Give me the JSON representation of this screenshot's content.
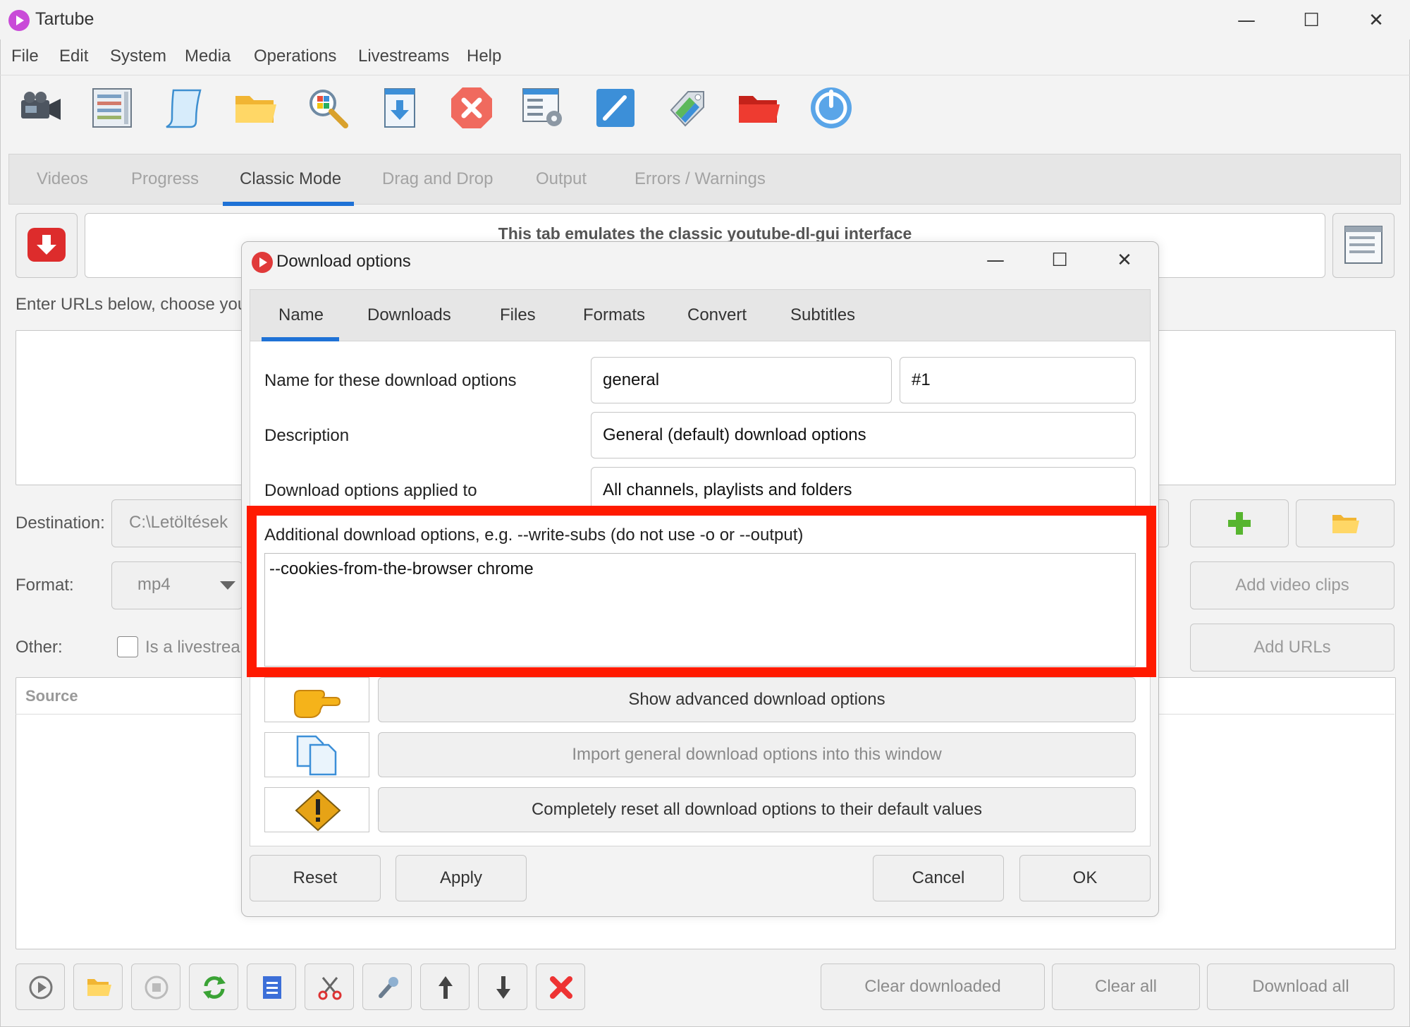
{
  "app": {
    "title": "Tartube",
    "window_controls": {
      "minimize": "—",
      "maximize": "☐",
      "close": "✕"
    }
  },
  "menubar": [
    "File",
    "Edit",
    "System",
    "Media",
    "Operations",
    "Livestreams",
    "Help"
  ],
  "toolbar_icons": [
    "camera-icon",
    "video-list-icon",
    "scroll-icon",
    "folder-icon",
    "search-icon",
    "download-icon",
    "stop-icon",
    "settings-icon",
    "edit-icon",
    "tag-icon",
    "red-folder-icon",
    "power-icon"
  ],
  "main_tabs": [
    {
      "label": "Videos",
      "active": false
    },
    {
      "label": "Progress",
      "active": false
    },
    {
      "label": "Classic Mode",
      "active": true
    },
    {
      "label": "Drag and Drop",
      "active": false
    },
    {
      "label": "Output",
      "active": false
    },
    {
      "label": "Errors / Warnings",
      "active": false
    }
  ],
  "classic": {
    "banner": "This tab emulates the classic youtube-dl-gui interface",
    "enter_urls_label": "Enter URLs below, choose your",
    "destination_label": "Destination:",
    "destination_value": "C:\\Letöltések",
    "format_label": "Format:",
    "format_value": "mp4",
    "other_label": "Other:",
    "livestream_label": "Is a livestream",
    "source_header": "Source",
    "add_video_clips": "Add video clips",
    "add_urls": "Add URLs",
    "clear_downloaded": "Clear downloaded",
    "clear_all": "Clear all",
    "download_all": "Download all"
  },
  "dialog": {
    "title": "Download options",
    "window_controls": {
      "minimize": "—",
      "maximize": "☐",
      "close": "✕"
    },
    "tabs": [
      {
        "label": "Name",
        "active": true
      },
      {
        "label": "Downloads",
        "active": false
      },
      {
        "label": "Files",
        "active": false
      },
      {
        "label": "Formats",
        "active": false
      },
      {
        "label": "Convert",
        "active": false
      },
      {
        "label": "Subtitles",
        "active": false
      }
    ],
    "name_label": "Name for these download options",
    "name_value": "general",
    "id_value": "#1",
    "description_label": "Description",
    "description_value": "General (default) download options",
    "applied_label": "Download options applied to",
    "applied_value": "All channels, playlists and folders",
    "additional_label": "Additional download options, e.g. --write-subs (do not use -o or --output)",
    "additional_value": "--cookies-from-the-browser chrome",
    "show_advanced": "Show advanced download options",
    "import_general": "Import general download options into this window",
    "reset_all": "Completely reset all download options to their default values",
    "reset": "Reset",
    "apply": "Apply",
    "cancel": "Cancel",
    "ok": "OK"
  },
  "colors": {
    "highlight": "#ff1a00",
    "accent": "#1f72d6"
  }
}
